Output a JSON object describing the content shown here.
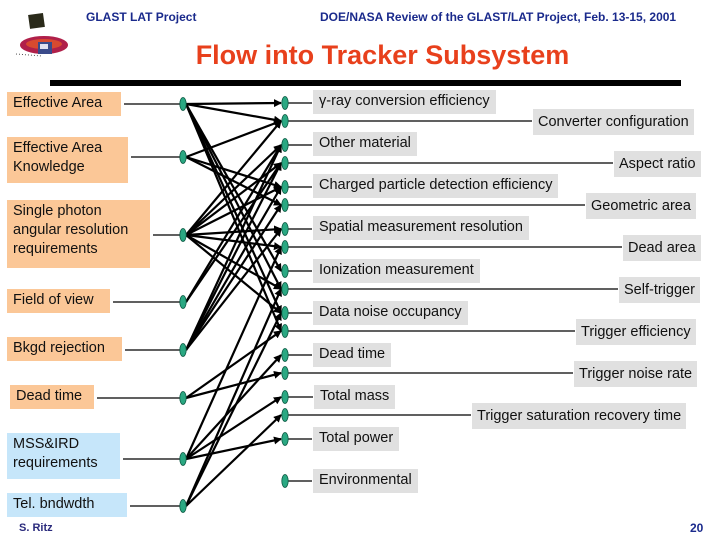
{
  "header": {
    "project": "GLAST LAT Project",
    "review": "DOE/NASA Review of the GLAST/LAT Project, Feb. 13-15, 2001"
  },
  "title": "Flow into Tracker Subsystem",
  "colors": {
    "header_text": "#1a2a8c",
    "title": "#e8401c",
    "requirement_box": "#fbc797",
    "external_box": "#c6e6fa",
    "parameter_box": "#e0e0e0",
    "node": "#2aa882"
  },
  "requirements": [
    {
      "id": "L1",
      "label": "Effective Area",
      "kind": "science"
    },
    {
      "id": "L2",
      "label": "Effective Area\nKnowledge",
      "kind": "science"
    },
    {
      "id": "L3",
      "label": "Single photon\nangular resolution\nrequirements",
      "kind": "science"
    },
    {
      "id": "L4",
      "label": "Field of view",
      "kind": "science"
    },
    {
      "id": "L5",
      "label": "Bkgd rejection",
      "kind": "science"
    },
    {
      "id": "L6",
      "label": "Dead time",
      "kind": "science"
    },
    {
      "id": "L7",
      "label": "MSS&IRD\nrequirements",
      "kind": "external"
    },
    {
      "id": "L8",
      "label": "Tel. bndwdth",
      "kind": "external"
    }
  ],
  "parameters": [
    {
      "id": "R1",
      "label": "γ-ray conversion efficiency",
      "column": "inner"
    },
    {
      "id": "R2",
      "label": "Converter configuration",
      "column": "outer"
    },
    {
      "id": "R3",
      "label": "Other material",
      "column": "inner"
    },
    {
      "id": "R4",
      "label": "Aspect ratio",
      "column": "outer"
    },
    {
      "id": "R5",
      "label": "Charged particle detection efficiency",
      "column": "inner"
    },
    {
      "id": "R6",
      "label": "Geometric area",
      "column": "outer"
    },
    {
      "id": "R7",
      "label": "Spatial measurement resolution",
      "column": "inner"
    },
    {
      "id": "R8",
      "label": "Dead area",
      "column": "outer"
    },
    {
      "id": "R9",
      "label": "Ionization measurement",
      "column": "inner"
    },
    {
      "id": "R10",
      "label": "Self-trigger",
      "column": "outer"
    },
    {
      "id": "R11",
      "label": "Data noise occupancy",
      "column": "inner"
    },
    {
      "id": "R12",
      "label": "Trigger efficiency",
      "column": "outer"
    },
    {
      "id": "R13",
      "label": "Dead time",
      "column": "inner"
    },
    {
      "id": "R14",
      "label": "Trigger noise rate",
      "column": "outer"
    },
    {
      "id": "R15",
      "label": "Total mass",
      "column": "inner"
    },
    {
      "id": "R16",
      "label": "Trigger saturation recovery time",
      "column": "outer"
    },
    {
      "id": "R17",
      "label": "Total power",
      "column": "inner"
    },
    {
      "id": "R18",
      "label": "Environmental",
      "column": "inner"
    }
  ],
  "flows": [
    [
      "L1",
      "R1"
    ],
    [
      "L1",
      "R2"
    ],
    [
      "L1",
      "R9"
    ],
    [
      "L1",
      "R10"
    ],
    [
      "L1",
      "R12"
    ],
    [
      "L1",
      "R11"
    ],
    [
      "L2",
      "R2"
    ],
    [
      "L2",
      "R5"
    ],
    [
      "L2",
      "R6"
    ],
    [
      "L3",
      "R2"
    ],
    [
      "L3",
      "R3"
    ],
    [
      "L3",
      "R4"
    ],
    [
      "L3",
      "R5"
    ],
    [
      "L3",
      "R7"
    ],
    [
      "L3",
      "R8"
    ],
    [
      "L3",
      "R10"
    ],
    [
      "L3",
      "R11"
    ],
    [
      "L4",
      "R3"
    ],
    [
      "L4",
      "R4"
    ],
    [
      "L5",
      "R3"
    ],
    [
      "L5",
      "R4"
    ],
    [
      "L5",
      "R5"
    ],
    [
      "L5",
      "R6"
    ],
    [
      "L5",
      "R7"
    ],
    [
      "L6",
      "R12"
    ],
    [
      "L6",
      "R14"
    ],
    [
      "L7",
      "R13"
    ],
    [
      "L7",
      "R15"
    ],
    [
      "L7",
      "R17"
    ],
    [
      "L7",
      "R8"
    ],
    [
      "L8",
      "R10"
    ],
    [
      "L8",
      "R11"
    ],
    [
      "L8",
      "R16"
    ]
  ],
  "footer": {
    "author": "S. Ritz",
    "page": "20"
  }
}
